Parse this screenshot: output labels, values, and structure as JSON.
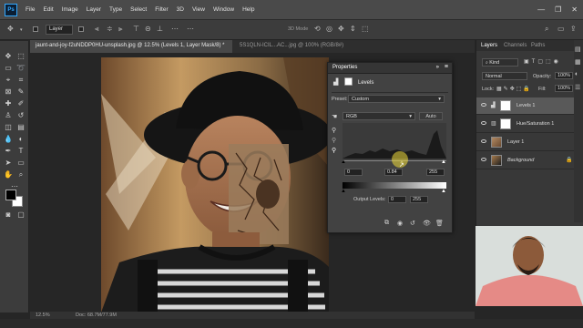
{
  "app": {
    "logo_text": "Ps",
    "menu": [
      "File",
      "Edit",
      "Image",
      "Layer",
      "Type",
      "Select",
      "Filter",
      "3D",
      "View",
      "Window",
      "Help"
    ],
    "window_controls": [
      "—",
      "❐",
      "✕"
    ]
  },
  "options_bar": {
    "auto_select_label": "Layer",
    "mode_label": "3D Mode"
  },
  "document": {
    "tabs": [
      {
        "label": "jaunt-and-joy-f2uNDDP0HU-unsplash.jpg @ 12.5% (Levels 1, Layer Mask/8) *",
        "active": true
      },
      {
        "label": "5S1QLN-ICIL...AC...jpg @ 100% (RGB/8#)",
        "active": false
      }
    ],
    "status_zoom": "12.5%",
    "status_doc": "Doc: 68.7M/77.9M"
  },
  "properties": {
    "title": "Properties",
    "adjustment_name": "Levels",
    "preset_label": "Preset:",
    "preset_value": "Custom",
    "channel_value": "RGB",
    "auto_label": "Auto",
    "input_black": "0",
    "input_mid": "0.84",
    "input_white": "255",
    "output_label": "Output Levels:",
    "output_black": "0",
    "output_white": "255"
  },
  "layers_panel": {
    "tabs": [
      "Layers",
      "Channels",
      "Paths"
    ],
    "filter_label": "Kind",
    "blend_mode": "Normal",
    "opacity_label": "Opacity:",
    "opacity_value": "100%",
    "lock_label": "Lock:",
    "fill_label": "Fill:",
    "fill_value": "100%",
    "layers": [
      {
        "name": "Levels 1",
        "selected": true
      },
      {
        "name": "Hue/Saturation 1",
        "selected": false
      },
      {
        "name": "Layer 1",
        "selected": false
      },
      {
        "name": "Background",
        "selected": false
      }
    ]
  },
  "colors": {
    "accent": "#31a8ff",
    "panel": "#424242",
    "selection": "#595959"
  }
}
